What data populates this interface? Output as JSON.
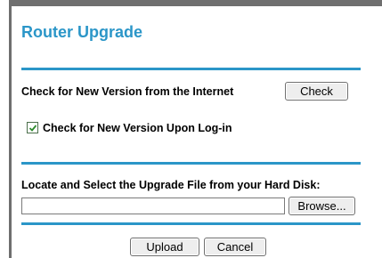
{
  "page": {
    "title": "Router Upgrade"
  },
  "check_section": {
    "label": "Check for New Version from the Internet",
    "check_button": "Check",
    "login_checkbox_label": "Check for New Version Upon Log-in",
    "login_checkbox_checked": true
  },
  "file_section": {
    "label": "Locate and Select the Upgrade File from your Hard Disk:",
    "file_path_value": "",
    "browse_button": "Browse..."
  },
  "actions": {
    "upload_button": "Upload",
    "cancel_button": "Cancel"
  },
  "colors": {
    "accent": "#2b96c8",
    "frame": "#6f6f6f",
    "checkmark": "#2e8b2e"
  }
}
